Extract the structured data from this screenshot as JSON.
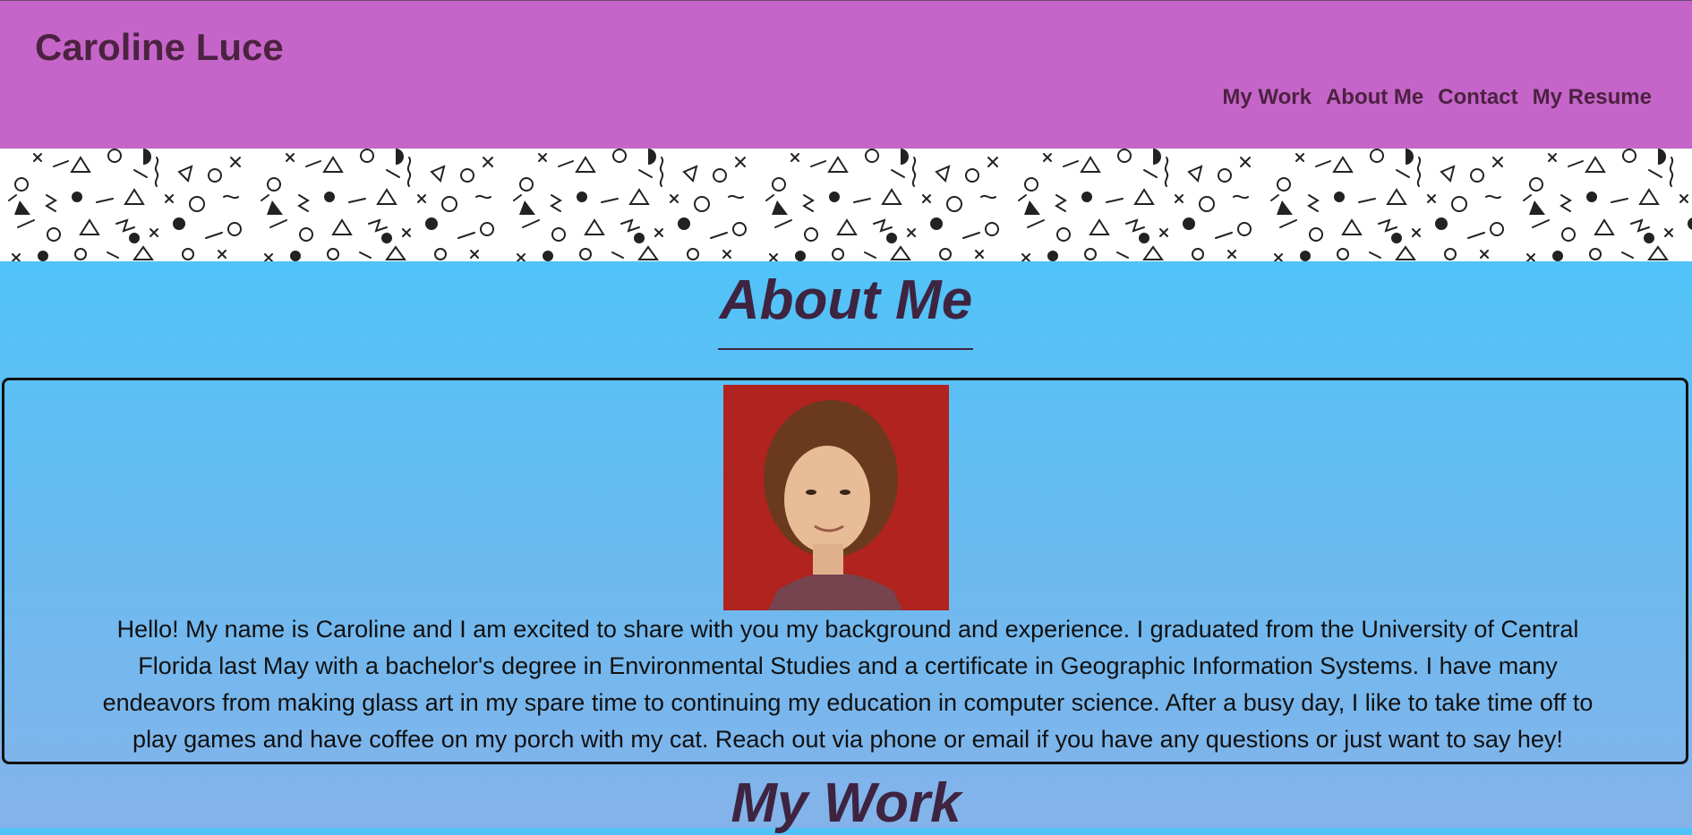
{
  "header": {
    "title": "Caroline Luce",
    "nav": [
      "My Work",
      "About Me",
      "Contact",
      "My Resume"
    ],
    "background": "#c665c9",
    "text_color": "#4b2240"
  },
  "about": {
    "heading": "About Me",
    "bio": "Hello! My name is Caroline and I am excited to share with you my background and experience. I graduated from the University of Central Florida last May with a bachelor's degree in Environmental Studies and a certificate in Geographic Information Systems. I have many endeavors from making glass art in my spare time to continuing my education in computer science. After a busy day, I like to take time off to play games and have coffee on my porch with my cat. Reach out via phone or email if you have any questions or just want to say hey!"
  },
  "work": {
    "heading": "My Work"
  },
  "colors": {
    "page_gradient_top": "#50c3f8",
    "page_gradient_bottom": "#84b3e9",
    "heading": "#3e2441"
  }
}
